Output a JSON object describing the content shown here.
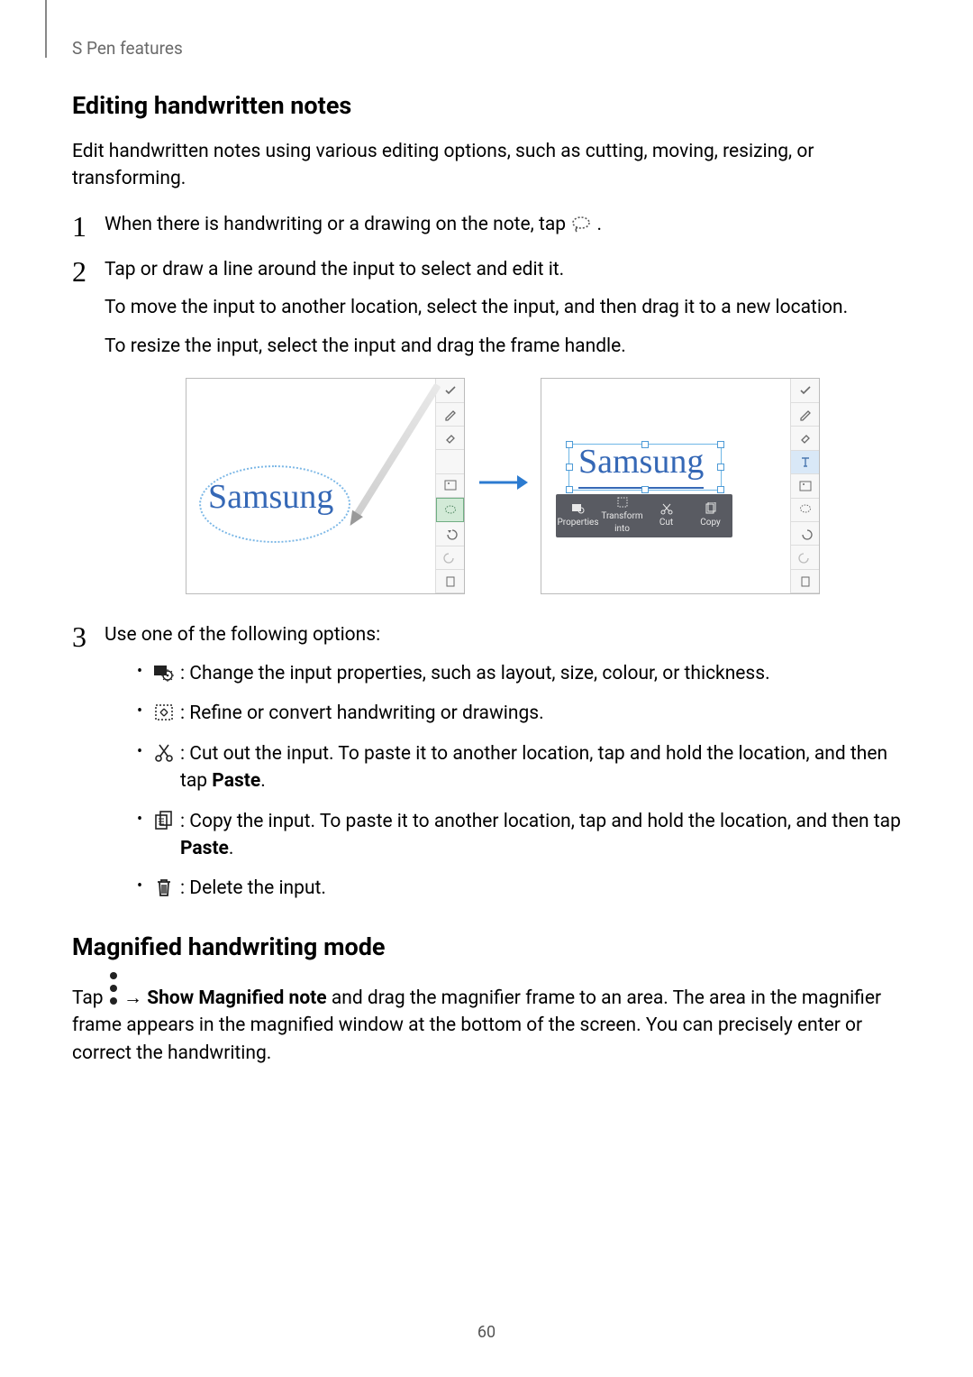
{
  "chapter": "S Pen features",
  "h2_editing": "Editing handwritten notes",
  "intro": "Edit handwritten notes using various editing options, such as cutting, moving, resizing, or transforming.",
  "step1": {
    "num": "1",
    "pre": "When there is handwriting or a drawing on the note, tap ",
    "post": "."
  },
  "step2": {
    "num": "2",
    "line1": "Tap or draw a line around the input to select and edit it.",
    "line2": "To move the input to another location, select the input, and then drag it to a new location.",
    "line3": "To resize the input, select the input and drag the frame handle."
  },
  "figure": {
    "handwritten": "Samsung",
    "context": {
      "properties": "Properties",
      "transform": "Transform\ninto",
      "cut": "Cut",
      "copy": "Copy"
    }
  },
  "step3": {
    "num": "3",
    "lead": "Use one of the following options:",
    "opts": [
      {
        "icon": "props-icon",
        "text": " : Change the input properties, such as layout, size, colour, or thickness."
      },
      {
        "icon": "transform-icon",
        "text": " : Refine or convert handwriting or drawings."
      },
      {
        "icon": "cut-icon",
        "pre": " : Cut out the input. To paste it to another location, tap and hold the location, and then tap ",
        "bold": "Paste",
        "post": "."
      },
      {
        "icon": "copy-icon",
        "pre": " : Copy the input. To paste it to another location, tap and hold the location, and then tap ",
        "bold": "Paste",
        "post": "."
      },
      {
        "icon": "delete-icon",
        "text": " : Delete the input."
      }
    ]
  },
  "h2_magnified": "Magnified handwriting mode",
  "magnified": {
    "pre": "Tap ",
    "arrow": " → ",
    "bold": "Show Magnified note",
    "post": " and drag the magnifier frame to an area. The area in the magnifier frame appears in the magnified window at the bottom of the screen. You can precisely enter or correct the handwriting."
  },
  "page_number": "60"
}
